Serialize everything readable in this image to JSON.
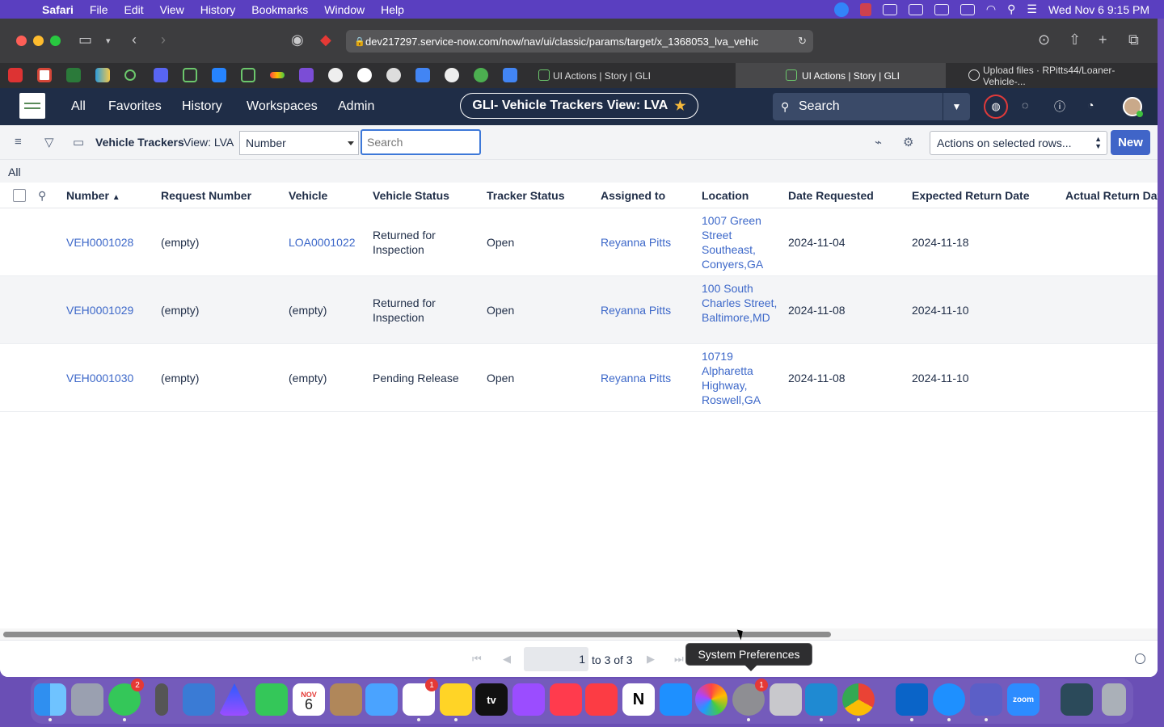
{
  "menubar": {
    "app": "Safari",
    "items": [
      "File",
      "Edit",
      "View",
      "History",
      "Bookmarks",
      "Window",
      "Help"
    ],
    "datetime": "Wed Nov 6  9:15 PM"
  },
  "browser": {
    "url": "dev217297.service-now.com/now/nav/ui/classic/params/target/x_1368053_lva_vehic",
    "tabs": [
      {
        "label": "UI Actions | Story | GLI"
      },
      {
        "label": "UI Actions | Story | GLI"
      },
      {
        "label": "Upload files · RPitts44/Loaner-Vehicle-..."
      }
    ]
  },
  "sn_header": {
    "nav": [
      "All",
      "Favorites",
      "History",
      "Workspaces",
      "Admin"
    ],
    "context_title": "GLI- Vehicle Trackers View: LVA",
    "search_placeholder": "Search"
  },
  "list": {
    "title": "Vehicle Trackers",
    "view": "View: LVA",
    "field_select": "Number",
    "search_placeholder": "Search",
    "actions_label": "Actions on selected rows...",
    "new_label": "New",
    "breadcrumb": "All",
    "columns": [
      "Number",
      "Request Number",
      "Vehicle",
      "Vehicle Status",
      "Tracker Status",
      "Assigned to",
      "Location",
      "Date Requested",
      "Expected Return Date",
      "Actual Return Date"
    ],
    "rows": [
      {
        "number": "VEH0001028",
        "request": "(empty)",
        "vehicle": "LOA0001022",
        "vehicle_status": "Returned for Inspection",
        "tracker_status": "Open",
        "assigned": "Reyanna Pitts",
        "location": "1007 Green Street Southeast, Conyers,GA",
        "date_requested": "2024-11-04",
        "expected_return": "2024-11-18"
      },
      {
        "number": "VEH0001029",
        "request": "(empty)",
        "vehicle": "(empty)",
        "vehicle_status": "Returned for Inspection",
        "tracker_status": "Open",
        "assigned": "Reyanna Pitts",
        "location": "100 South Charles Street, Baltimore,MD",
        "date_requested": "2024-11-08",
        "expected_return": "2024-11-10"
      },
      {
        "number": "VEH0001030",
        "request": "(empty)",
        "vehicle": "(empty)",
        "vehicle_status": "Pending Release",
        "tracker_status": "Open",
        "assigned": "Reyanna Pitts",
        "location": "10719 Alpharetta Highway, Roswell,GA",
        "date_requested": "2024-11-08",
        "expected_return": "2024-11-10"
      }
    ],
    "pager": {
      "page": "1",
      "range": "to 3 of 3"
    }
  },
  "tooltip": "System Preferences",
  "dock": {
    "messages_badge": "2",
    "reminders_badge": "1",
    "calendar_month": "NOV",
    "calendar_day": "6",
    "sysprefs_badge": "1",
    "tv_label": "tv",
    "zoom_label": "zoom"
  }
}
